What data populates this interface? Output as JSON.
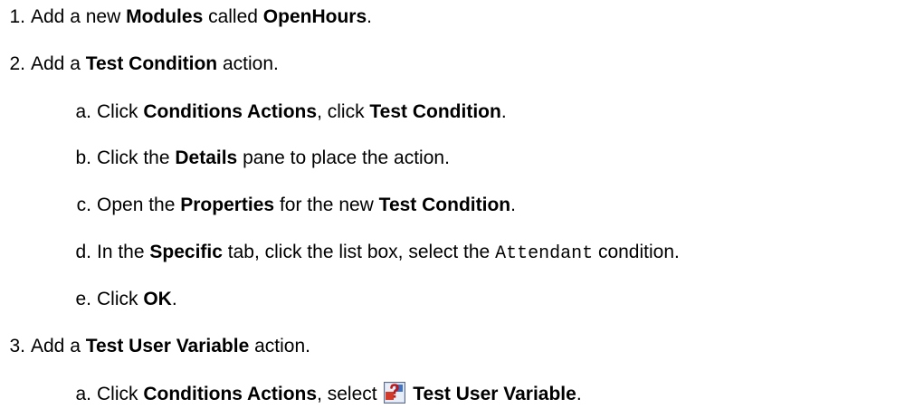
{
  "steps": [
    {
      "marker": "1.",
      "parts": [
        {
          "t": "Add a new "
        },
        {
          "t": "Modules",
          "b": true
        },
        {
          "t": " called "
        },
        {
          "t": "OpenHours",
          "b": true
        },
        {
          "t": "."
        }
      ]
    },
    {
      "marker": "2.",
      "parts": [
        {
          "t": "Add a "
        },
        {
          "t": "Test Condition",
          "b": true
        },
        {
          "t": " action."
        }
      ],
      "substeps": [
        {
          "marker": "a.",
          "parts": [
            {
              "t": "Click "
            },
            {
              "t": "Conditions Actions",
              "b": true
            },
            {
              "t": ", click "
            },
            {
              "t": "Test Condition",
              "b": true
            },
            {
              "t": "."
            }
          ]
        },
        {
          "marker": "b.",
          "parts": [
            {
              "t": "Click the "
            },
            {
              "t": "Details",
              "b": true
            },
            {
              "t": " pane to place the action."
            }
          ]
        },
        {
          "marker": "c.",
          "parts": [
            {
              "t": "Open the "
            },
            {
              "t": "Properties",
              "b": true
            },
            {
              "t": " for the new "
            },
            {
              "t": "Test Condition",
              "b": true
            },
            {
              "t": "."
            }
          ]
        },
        {
          "marker": "d.",
          "parts": [
            {
              "t": "In the "
            },
            {
              "t": "Specific",
              "b": true
            },
            {
              "t": " tab, click the list box, select the "
            },
            {
              "t": "Attendant",
              "code": true
            },
            {
              "t": " condition."
            }
          ]
        },
        {
          "marker": "e.",
          "parts": [
            {
              "t": "Click "
            },
            {
              "t": "OK",
              "b": true
            },
            {
              "t": "."
            }
          ]
        }
      ]
    },
    {
      "marker": "3.",
      "parts": [
        {
          "t": "Add a "
        },
        {
          "t": "Test User Variable",
          "b": true
        },
        {
          "t": " action."
        }
      ],
      "substeps": [
        {
          "marker": "a.",
          "parts": [
            {
              "t": "Click "
            },
            {
              "t": "Conditions Actions",
              "b": true
            },
            {
              "t": ", select "
            },
            {
              "icon": "test-user-variable-icon"
            },
            {
              "t": " "
            },
            {
              "t": "Test User Variable",
              "b": true
            },
            {
              "t": "."
            }
          ]
        }
      ]
    }
  ]
}
